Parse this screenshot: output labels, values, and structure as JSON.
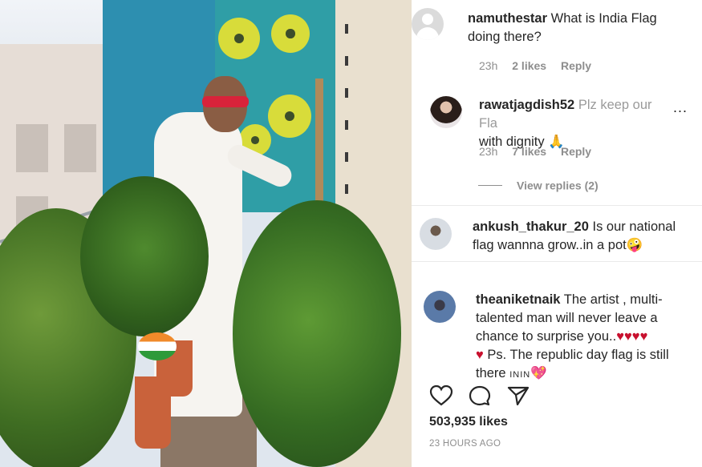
{
  "post": {
    "image_alt": "Man in white kurta painting a mural on a teal balcony wall among potted plants",
    "likes_count": "503,935 likes",
    "time_ago": "23 HOURS AGO"
  },
  "comments": [
    {
      "username": "namuthestar",
      "text": "What is India Flag",
      "text_line2": "doing there?",
      "time": "23h",
      "likes": "2 likes",
      "reply_label": "Reply"
    },
    {
      "username": "rawatjagdish52",
      "text": "Plz keep our Fla",
      "text_line2": "with dignity",
      "emoji": "🙏",
      "time": "23h",
      "likes": "7 likes",
      "reply_label": "Reply",
      "more": "...",
      "view_replies": "View replies (2)"
    },
    {
      "username": "ankush_thakur_20",
      "text": "Is our national",
      "text_line2": "flag wannna grow..in a pot",
      "emoji": "🤪"
    },
    {
      "username": "theaniketnaik",
      "text": "The artist , multi-",
      "text_line2": "talented man will never leave a",
      "text_line3": "chance to surprise you..",
      "hearts_line3": "♥♥♥♥",
      "heart_line4": "♥",
      "text_line4": "Ps. The republic day flag is still",
      "text_line5": "there",
      "tag_line5": "ININ",
      "heart_line5": "💖"
    }
  ],
  "icons": {
    "like": "heart-icon",
    "comment": "comment-icon",
    "share": "share-icon"
  },
  "colors": {
    "text": "#262626",
    "muted": "#8e8e8e",
    "heart": "#c8102e"
  }
}
